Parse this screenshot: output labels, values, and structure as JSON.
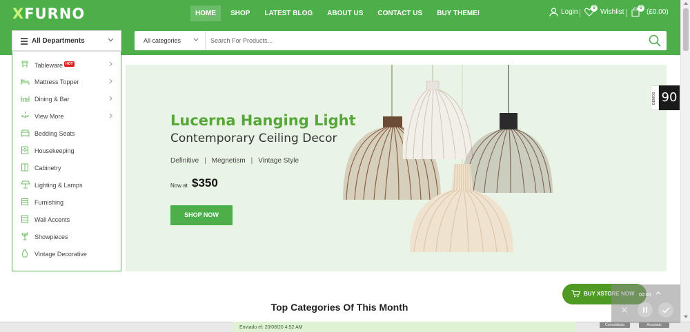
{
  "brand": {
    "logo_x": "X",
    "logo_rest": "FURNO"
  },
  "nav": [
    {
      "label": "HOME",
      "active": true
    },
    {
      "label": "SHOP",
      "active": false
    },
    {
      "label": "LATEST BLOG",
      "active": false
    },
    {
      "label": "ABOUT US",
      "active": false
    },
    {
      "label": "CONTACT US",
      "active": false
    },
    {
      "label": "BUY THEME!",
      "active": false
    }
  ],
  "header_utils": {
    "login": "Login",
    "wishlist": "Wishlist",
    "wishlist_count": "0",
    "cart_count": "0",
    "cart_total": "(£0.00)"
  },
  "departments": {
    "label": "All Departments",
    "items": [
      {
        "label": "Tableware",
        "badge": "HOT",
        "has_submenu": true,
        "icon": "table-icon"
      },
      {
        "label": "Mattress Topper",
        "has_submenu": true,
        "icon": "bed-icon"
      },
      {
        "label": "Dining & Bar",
        "has_submenu": true,
        "icon": "dining-table-icon"
      },
      {
        "label": "View More",
        "has_submenu": true,
        "icon": "chandelier-icon"
      },
      {
        "label": "Bedding Seats",
        "has_submenu": false,
        "icon": "sofa-icon"
      },
      {
        "label": "Housekeeping",
        "has_submenu": false,
        "icon": "cabinet-icon"
      },
      {
        "label": "Cabinetry",
        "has_submenu": false,
        "icon": "cupboard-icon"
      },
      {
        "label": "Lighting & Lamps",
        "has_submenu": false,
        "icon": "lamp-icon"
      },
      {
        "label": "Furnishing",
        "has_submenu": false,
        "icon": "drawer-icon"
      },
      {
        "label": "Wall Accents",
        "has_submenu": false,
        "icon": "shelf-icon"
      },
      {
        "label": "Showpieces",
        "has_submenu": false,
        "icon": "plant-icon"
      },
      {
        "label": "Vintage Decorative",
        "has_submenu": false,
        "icon": "vase-icon"
      }
    ]
  },
  "search": {
    "category_value": "All categories",
    "placeholder": "Search For Products..."
  },
  "hero": {
    "title": "Lucerna Hanging Light",
    "subtitle": "Contemporary Ceiling Decor",
    "tags": [
      "Definitive",
      "Megnetism",
      "Vintage Style"
    ],
    "price_label": "Now at",
    "price": "$350",
    "cta": "SHOP NOW"
  },
  "side_widgets": {
    "demos_label": "DEMOS",
    "counter": "90"
  },
  "section": {
    "title": "Top Categories Of This Month"
  },
  "buy_button": {
    "label": "BUY XSTORE NOW"
  },
  "recorder": {
    "time": "00:00"
  },
  "bottom": {
    "sent_text": "Enviado el: 20/08/20 4:52 AM",
    "btn_left": "Consolidada",
    "btn_right": "Aceptado"
  },
  "colors": {
    "brand_green": "#4caf4a",
    "title_green": "#56a63a",
    "hero_bg": "#eaf4e6",
    "hot_badge": "#e02020",
    "counter_bg": "#1a1a1a"
  }
}
